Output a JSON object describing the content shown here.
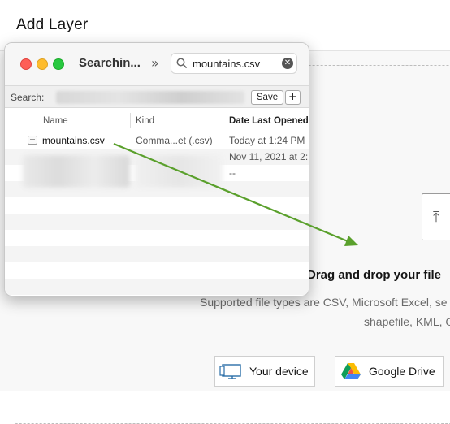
{
  "dialog": {
    "title": "Add Layer",
    "drop_title": "Drag and drop your file",
    "drop_subtitle_line1": "Supported file types are CSV, Microsoft Excel, se",
    "drop_subtitle_line2": "shapefile, KML, G",
    "upload_icon": "upload-document-icon",
    "buttons": {
      "device_label": "Your device",
      "device_icon": "monitor-icon",
      "drive_label": "Google Drive",
      "drive_icon": "google-drive-icon"
    }
  },
  "finder": {
    "window_title": "Searchin...",
    "overflow_icon": "double-chevron-right-icon",
    "search": {
      "value": "mountains.csv",
      "icon": "search-icon",
      "clear_icon": "clear-icon"
    },
    "scope": {
      "label": "Search:",
      "save_label": "Save",
      "add_label": "+"
    },
    "columns": [
      "Name",
      "Kind",
      "Date Last Opened"
    ],
    "rows": [
      {
        "name": "mountains.csv",
        "kind": "Comma...et (.csv)",
        "date": "Today at 1:24 PM"
      },
      {
        "name": "",
        "kind": "",
        "date": "Nov 11, 2021 at 2:"
      },
      {
        "name": "",
        "kind": "",
        "date": "--"
      }
    ],
    "traffic_lights": {
      "red": "#fe5f57",
      "yellow": "#febc2e",
      "green": "#28c840"
    }
  },
  "drag_indicator": {
    "color": "#5aa02c",
    "icon": "drag-arrow-icon"
  }
}
